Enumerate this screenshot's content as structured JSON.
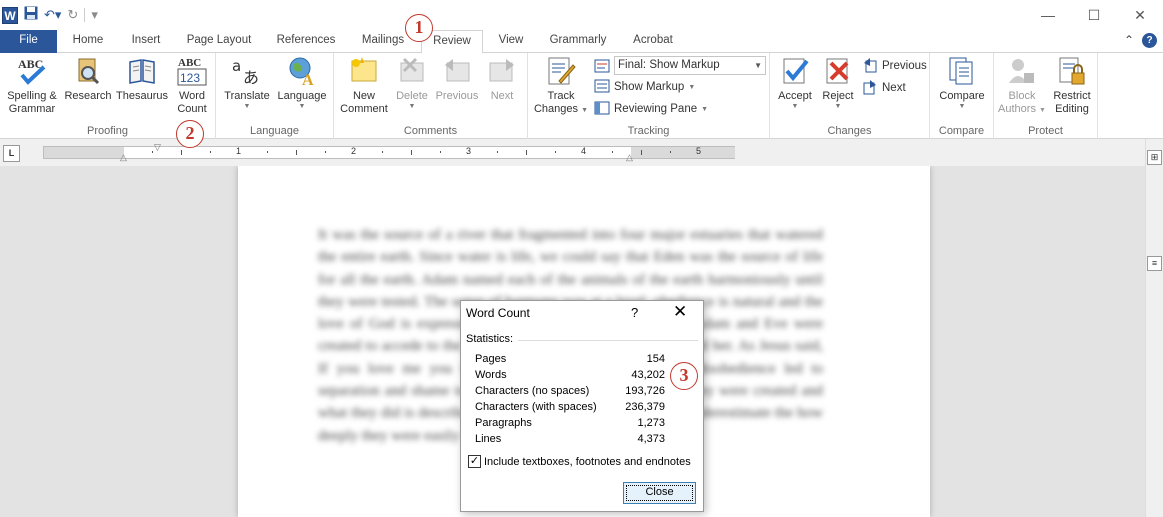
{
  "titlebar": {
    "app_icon": "W",
    "controls": [
      "—",
      "☐",
      "✕"
    ]
  },
  "tabs": {
    "file": "File",
    "items": [
      "Home",
      "Insert",
      "Page Layout",
      "References",
      "Mailings",
      "Review",
      "View",
      "Grammarly",
      "Acrobat"
    ],
    "active": "Review"
  },
  "ribbon": {
    "proofing": {
      "label": "Proofing",
      "spelling": "Spelling &",
      "spelling2": "Grammar",
      "research": "Research",
      "thesaurus": "Thesaurus",
      "wordcount": "Word",
      "wordcount2": "Count",
      "wordcount_icon_text1": "ABC",
      "wordcount_icon_text2": "123",
      "spelling_icon_text": "ABC"
    },
    "language": {
      "label": "Language",
      "translate": "Translate",
      "language": "Language"
    },
    "comments": {
      "label": "Comments",
      "new": "New",
      "new2": "Comment",
      "delete": "Delete",
      "previous": "Previous",
      "next": "Next"
    },
    "tracking": {
      "label": "Tracking",
      "track": "Track",
      "track2": "Changes",
      "markup_select": "Final: Show Markup",
      "show_markup": "Show Markup",
      "reviewing_pane": "Reviewing Pane"
    },
    "changes": {
      "label": "Changes",
      "accept": "Accept",
      "reject": "Reject",
      "previous": "Previous",
      "next": "Next"
    },
    "compare": {
      "label": "Compare",
      "compare": "Compare"
    },
    "protect": {
      "label": "Protect",
      "block": "Block",
      "block2": "Authors",
      "restrict": "Restrict",
      "restrict2": "Editing"
    }
  },
  "ruler": {
    "numbers": [
      "1",
      "2",
      "3",
      "4",
      "5"
    ]
  },
  "document": {
    "text": "It was the source of a river that fragmented into four major estuaries that watered the entire earth. Since water is life, we could say that Eden was the source of life for all the earth. Adam named each of the animals of the earth harmoniously until they were tested. The sense of harmony was at a level, obedience is natural and the love of God is expressed as willing the good of the other. Adam and Eve were created to accede to the other. We can see this in how he treated her. As Jesus said, If you love me you will keep my commandments. The disobedience led to separation and shame to eternity, although the story of how they were created and what they did is described in a few sentences, we should not underestimate the how deeply they were easily deceived."
  },
  "dialog": {
    "title": "Word Count",
    "help": "?",
    "close_x": "✕",
    "statistics_label": "Statistics:",
    "stats": [
      {
        "label": "Pages",
        "value": "154"
      },
      {
        "label": "Words",
        "value": "43,202"
      },
      {
        "label": "Characters (no spaces)",
        "value": "193,726"
      },
      {
        "label": "Characters (with spaces)",
        "value": "236,379"
      },
      {
        "label": "Paragraphs",
        "value": "1,273"
      },
      {
        "label": "Lines",
        "value": "4,373"
      }
    ],
    "checkbox_label": "Include textboxes, footnotes and endnotes",
    "checkbox_checked": true,
    "close_button": "Close"
  },
  "callouts": [
    "1",
    "2",
    "3"
  ]
}
